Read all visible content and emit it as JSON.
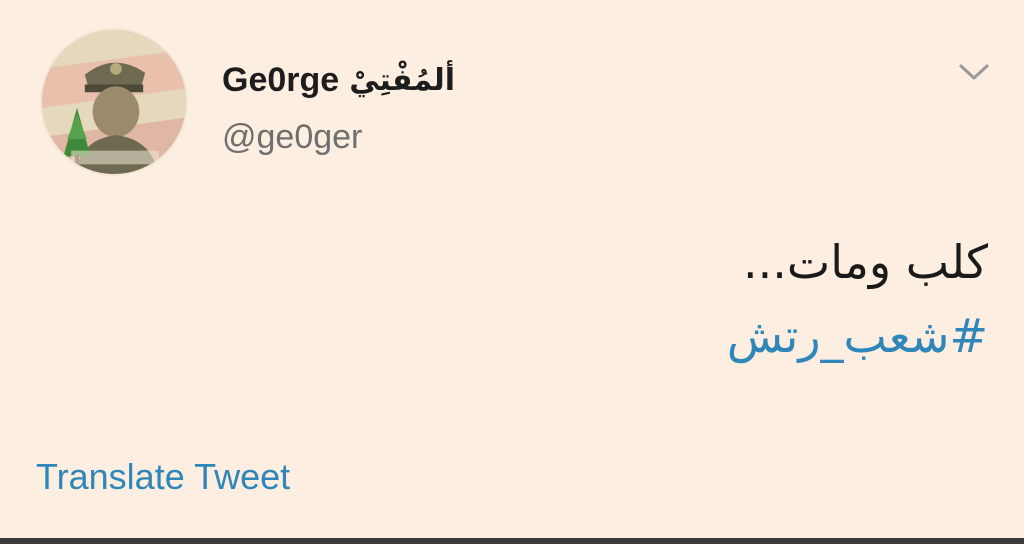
{
  "author": {
    "display_name": "Ge0rge",
    "display_name_ar": "ألمُفْتِيْ",
    "handle": "@ge0ger",
    "avatar": "portrait-with-cedar-icon"
  },
  "menu": {
    "icon": "chevron-down-icon"
  },
  "tweet": {
    "text": "كلب ومات...",
    "hashtag": "#شعب_رتش"
  },
  "actions": {
    "translate_label": "Translate Tweet"
  },
  "colors": {
    "background": "#fdeee2",
    "link": "#2f86b8",
    "text": "#1a1a1a",
    "muted": "#6f6f6f"
  }
}
